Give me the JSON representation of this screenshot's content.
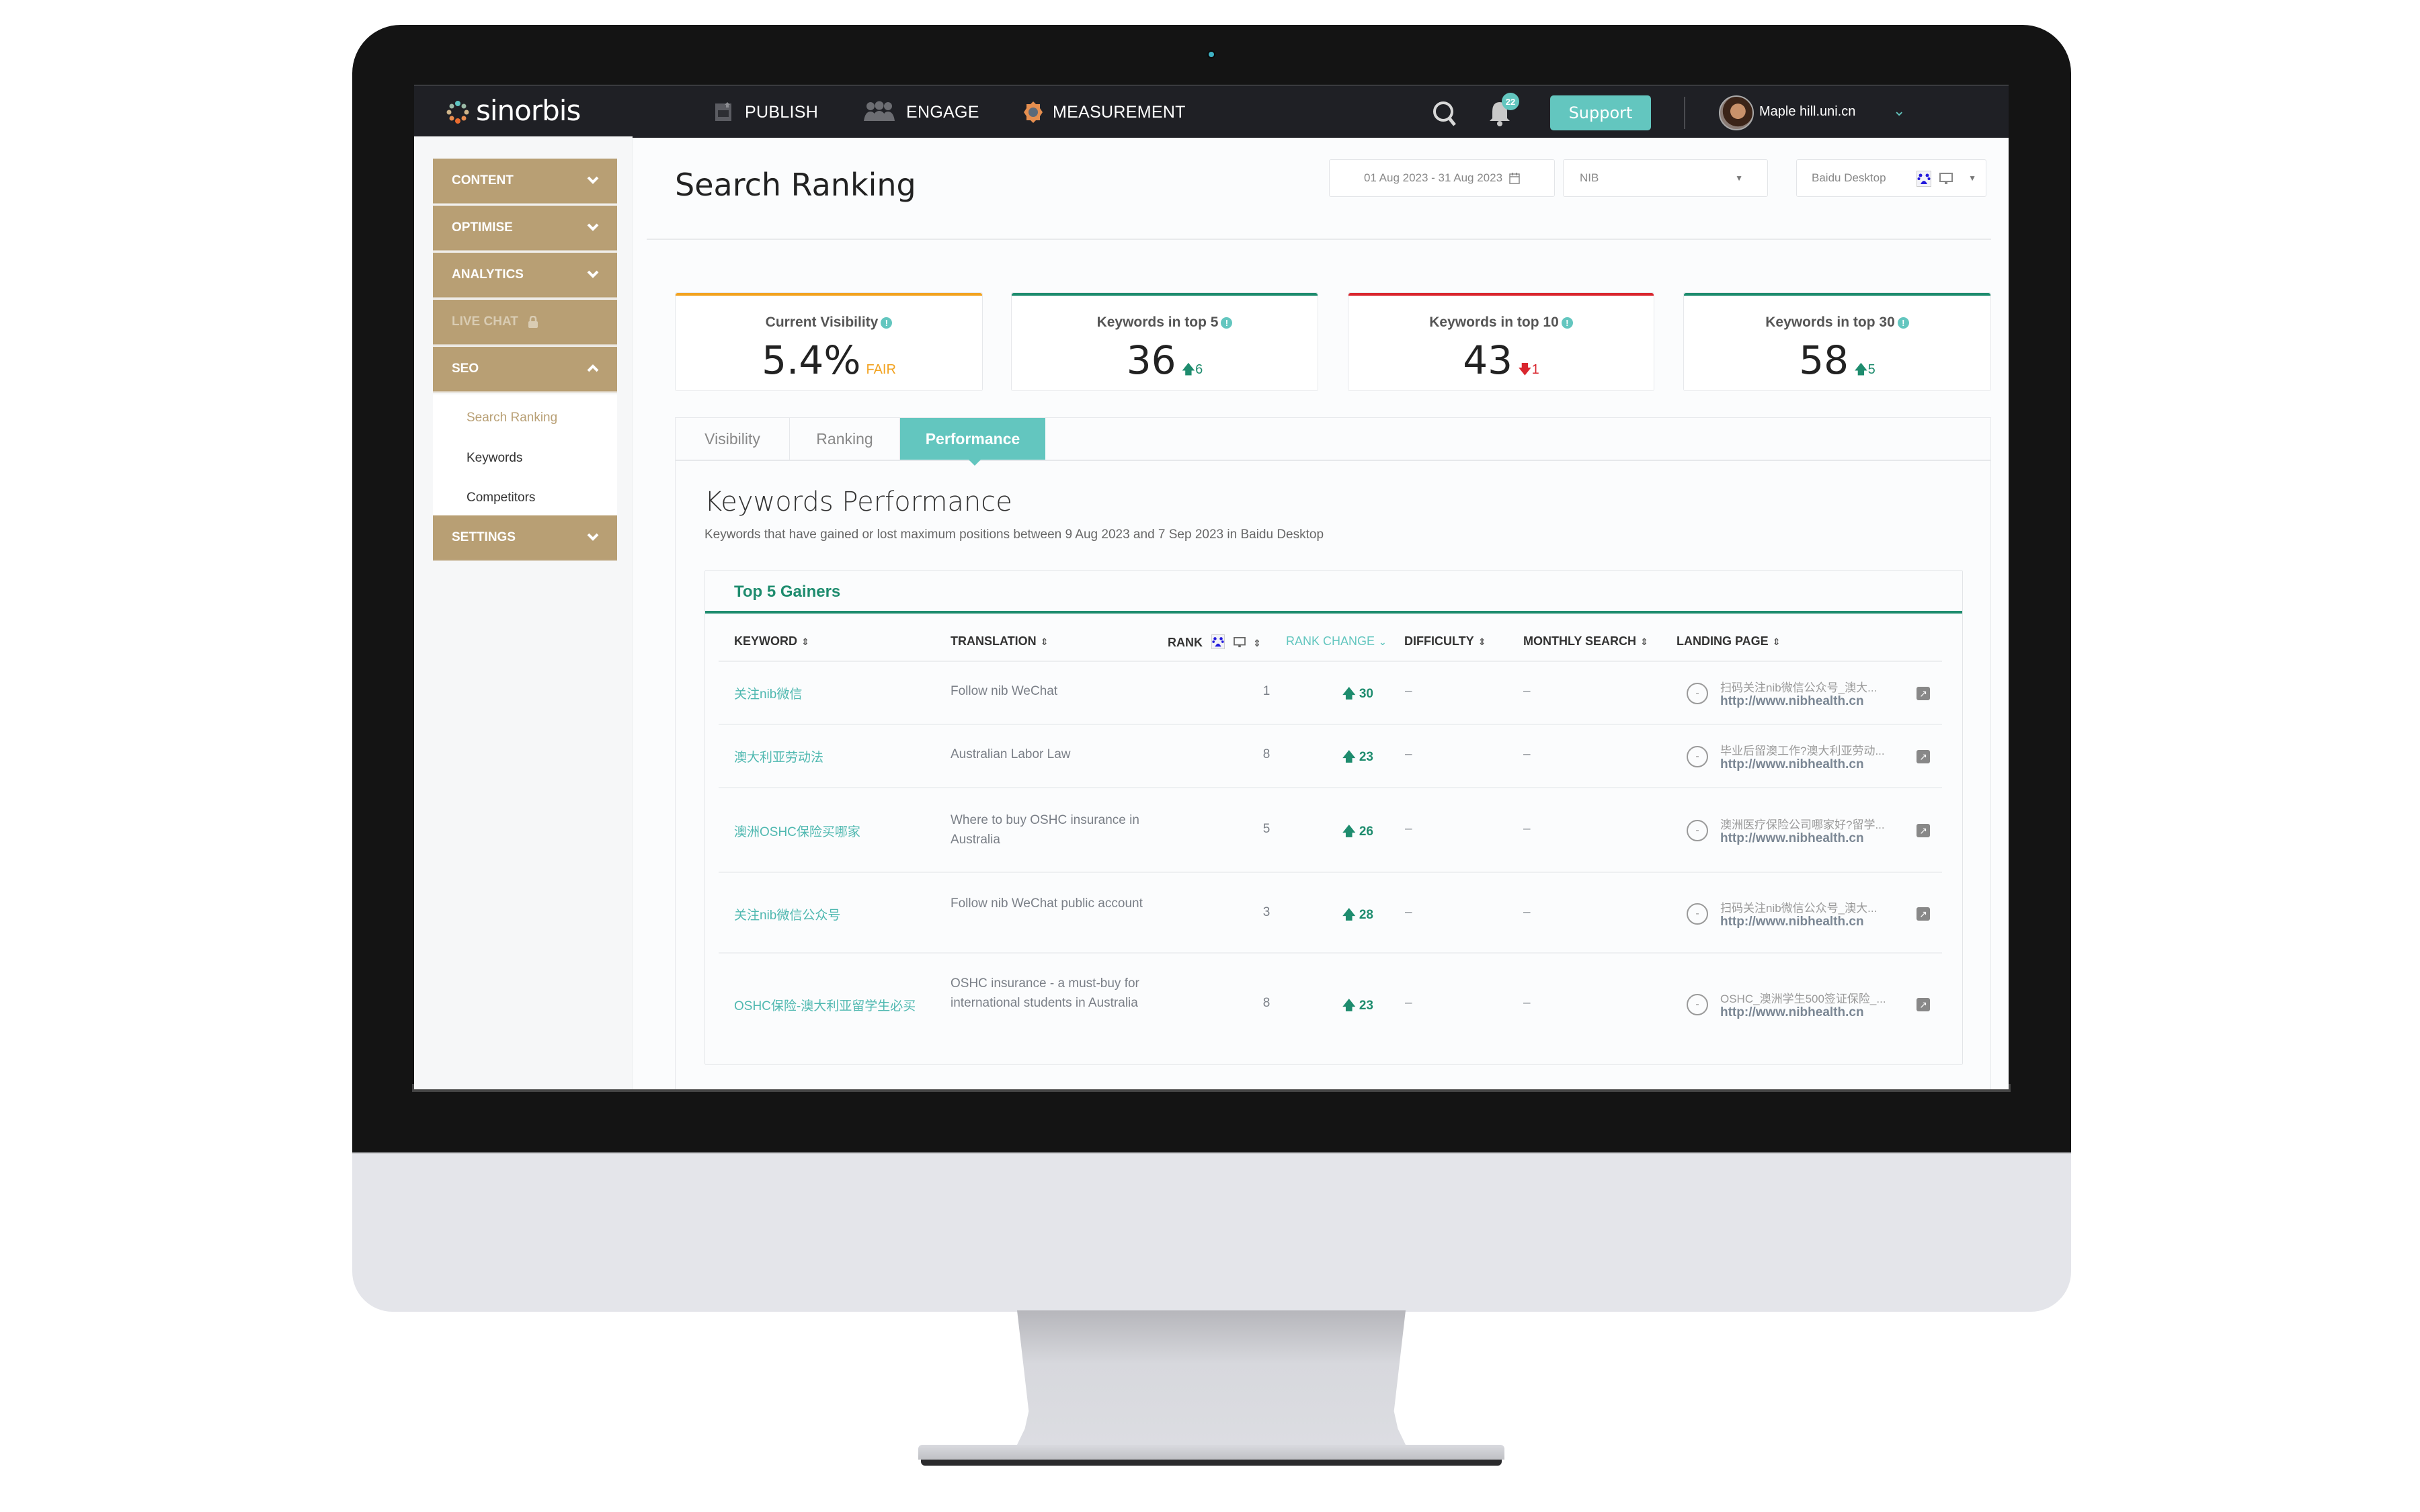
{
  "app": {
    "brand": "sinorbis",
    "accent": "#63c6bf",
    "sidebar_color": "#b89f74",
    "gain_color": "#1e8c6e",
    "loss_color": "#d9262e",
    "warn_color": "#f2a321"
  },
  "nav": {
    "items": [
      {
        "label": "PUBLISH",
        "icon": "publish-icon"
      },
      {
        "label": "ENGAGE",
        "icon": "people-icon"
      },
      {
        "label": "MEASUREMENT",
        "icon": "gear-icon"
      }
    ],
    "notification_count": "22",
    "support_label": "Support",
    "user_name": "Maple hill.uni.cn"
  },
  "sidebar": {
    "items": [
      {
        "label": "CONTENT",
        "state": "collapsed"
      },
      {
        "label": "OPTIMISE",
        "state": "collapsed"
      },
      {
        "label": "ANALYTICS",
        "state": "collapsed"
      },
      {
        "label": "LIVE CHAT",
        "state": "locked"
      },
      {
        "label": "SEO",
        "state": "expanded"
      },
      {
        "label": "SETTINGS",
        "state": "collapsed"
      }
    ],
    "seo_subitems": [
      {
        "label": "Search Ranking",
        "active": true
      },
      {
        "label": "Keywords",
        "active": false
      },
      {
        "label": "Competitors",
        "active": false
      }
    ]
  },
  "header": {
    "title": "Search Ranking",
    "date_range": "01 Aug 2023 - 31 Aug 2023",
    "project": "NIB",
    "engine": "Baidu Desktop"
  },
  "cards": [
    {
      "label": "Current Visibility",
      "value": "5.4%",
      "delta": "FAIR",
      "delta_dir": "none"
    },
    {
      "label": "Keywords in top 5",
      "value": "36",
      "delta": "6",
      "delta_dir": "up"
    },
    {
      "label": "Keywords in top 10",
      "value": "43",
      "delta": "1",
      "delta_dir": "down"
    },
    {
      "label": "Keywords in top 30",
      "value": "58",
      "delta": "5",
      "delta_dir": "up"
    }
  ],
  "tabs": [
    {
      "label": "Visibility",
      "active": false
    },
    {
      "label": "Ranking",
      "active": false
    },
    {
      "label": "Performance",
      "active": true
    }
  ],
  "performance": {
    "title": "Keywords Performance",
    "subtitle": "Keywords that have gained or lost maximum positions between 9 Aug 2023 and 7 Sep 2023 in Baidu Desktop",
    "table_title": "Top 5 Gainers",
    "columns": [
      "KEYWORD",
      "TRANSLATION",
      "RANK",
      "RANK CHANGE",
      "DIFFICULTY",
      "MONTHLY SEARCH",
      "LANDING PAGE"
    ],
    "sorted_column": "RANK CHANGE",
    "rows": [
      {
        "keyword": "关注nib微信",
        "translation": "Follow nib WeChat",
        "rank": "1",
        "change": "30",
        "difficulty": "–",
        "monthly_search": "–",
        "lp_title": "扫码关注nib微信公众号_澳大...",
        "lp_url": "http://www.nibhealth.cn"
      },
      {
        "keyword": "澳大利亚劳动法",
        "translation": "Australian Labor Law",
        "rank": "8",
        "change": "23",
        "difficulty": "–",
        "monthly_search": "–",
        "lp_title": "毕业后留澳工作?澳大利亚劳动...",
        "lp_url": "http://www.nibhealth.cn"
      },
      {
        "keyword": "澳洲OSHC保险买哪家",
        "translation": "Where to buy OSHC insurance in Australia",
        "rank": "5",
        "change": "26",
        "difficulty": "–",
        "monthly_search": "–",
        "lp_title": "澳洲医疗保险公司哪家好?留学...",
        "lp_url": "http://www.nibhealth.cn"
      },
      {
        "keyword": "关注nib微信公众号",
        "translation": "Follow nib WeChat public account",
        "rank": "3",
        "change": "28",
        "difficulty": "–",
        "monthly_search": "–",
        "lp_title": "扫码关注nib微信公众号_澳大...",
        "lp_url": "http://www.nibhealth.cn"
      },
      {
        "keyword": "OSHC保险-澳大利亚留学生必买",
        "translation": "OSHC insurance - a must-buy for international students in Australia",
        "rank": "8",
        "change": "23",
        "difficulty": "–",
        "monthly_search": "–",
        "lp_title": "OSHC_澳洲学生500签证保险_...",
        "lp_url": "http://www.nibhealth.cn"
      }
    ]
  }
}
